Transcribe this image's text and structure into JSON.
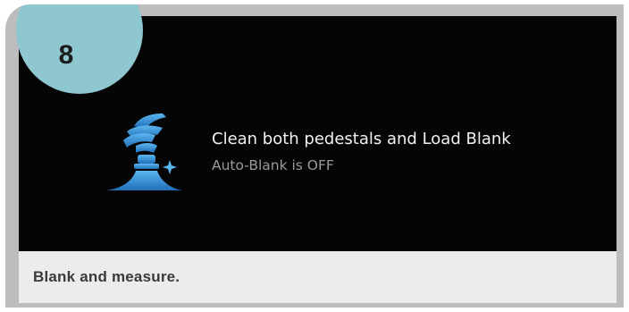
{
  "step": {
    "number": "8"
  },
  "screen": {
    "icon": "clean-pedestal-wipe-icon",
    "title": "Clean both pedestals and Load Blank",
    "subtitle": "Auto-Blank is OFF"
  },
  "caption": {
    "text": "Blank and measure."
  },
  "colors": {
    "badge": "#8fc7d1",
    "screen_bg": "#050505",
    "icon_blue": "#2e8fd6",
    "frame": "#bdbdbd",
    "caption_bg": "#ececee"
  }
}
